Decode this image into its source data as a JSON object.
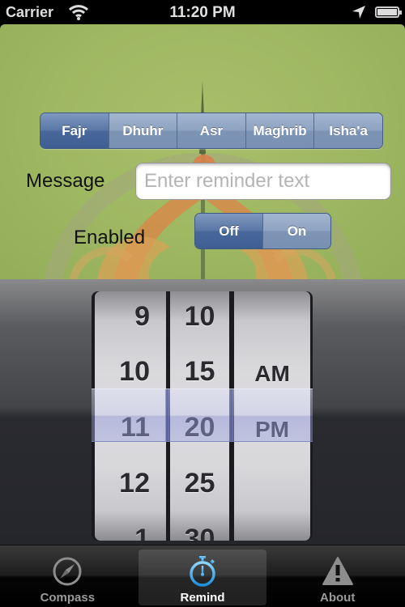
{
  "status_bar": {
    "carrier": "Carrier",
    "time": "11:20 PM"
  },
  "prayer_selector": {
    "options": [
      "Fajr",
      "Dhuhr",
      "Asr",
      "Maghrib",
      "Isha'a"
    ],
    "selected": "Fajr"
  },
  "message": {
    "label": "Message",
    "value": "",
    "placeholder": "Enter reminder text"
  },
  "enabled": {
    "label": "Enabled",
    "options": [
      "Off",
      "On"
    ],
    "selected": "Off"
  },
  "time_picker": {
    "hours": [
      "9",
      "10",
      "11",
      "12",
      "1"
    ],
    "minutes": [
      "10",
      "15",
      "20",
      "25",
      "30"
    ],
    "periods": [
      "",
      "AM",
      "PM",
      "",
      ""
    ],
    "selected": {
      "hour": "11",
      "minute": "20",
      "period": "PM"
    }
  },
  "tab_bar": {
    "tabs": [
      {
        "label": "Compass",
        "icon": "compass-icon"
      },
      {
        "label": "Remind",
        "icon": "stopwatch-icon"
      },
      {
        "label": "About",
        "icon": "warning-icon"
      }
    ],
    "active": "Remind"
  },
  "colors": {
    "segment_selected": "#48679a",
    "segment_normal": "#8ea3c1",
    "background_green": "#9fb862",
    "active_tab_icon": "#3fa9e8"
  }
}
